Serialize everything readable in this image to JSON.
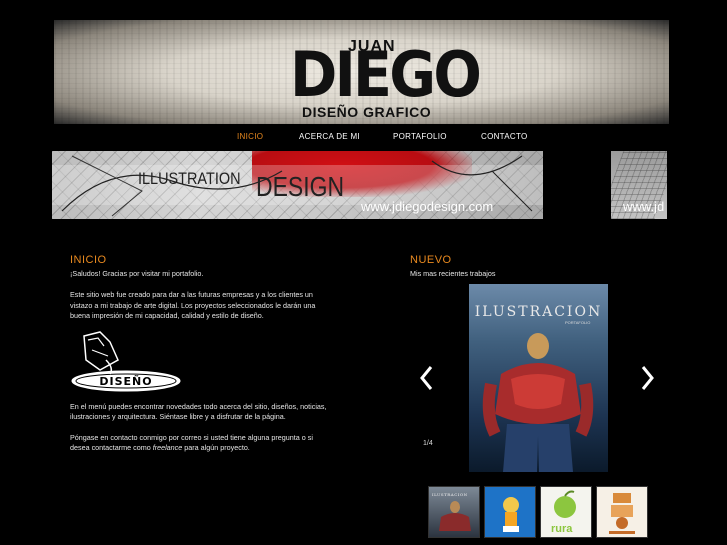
{
  "header": {
    "logo_juan": "JUAN",
    "logo_diego": "DIEGO",
    "logo_subtitle": "DISEÑO GRAFICO"
  },
  "nav": {
    "items": [
      {
        "label": "INICIO",
        "active": true
      },
      {
        "label": "ACERCA DE MI",
        "active": false
      },
      {
        "label": "PORTAFOLIO",
        "active": false
      },
      {
        "label": "CONTACTO",
        "active": false
      }
    ],
    "active_color": "#e8891f"
  },
  "banner": {
    "word1": "ILLUSTRATION",
    "word2": "DESIGN",
    "url": "www.jdiegodesign.com",
    "side_url": "www.jd"
  },
  "inicio": {
    "heading": "INICIO",
    "greeting": "¡Saludos! Gracias por visitar mi portafolio.",
    "intro": "Este sitio web fue creado para dar a las futuras empresas y a los clientes un vistazo a mi trabajo de arte digital. Los proyectos seleccionados le darán una buena impresión de mi capacidad, calidad y estilo de diseño.",
    "sketch_label": "DISEÑO",
    "menu_text": "En el menú puedes encontrar novedades todo acerca del sitio, diseños, noticias, ilustraciones y arquitectura. Siéntase libre y a disfrutar de la página.",
    "contact_text_before": "Póngase en contacto conmigo por correo si usted tiene alguna pregunta o si desea contactarme como ",
    "contact_text_em": "freelance",
    "contact_text_after": " para algún proyecto."
  },
  "nuevo": {
    "heading": "NUEVO",
    "subtitle": "Mis mas recientes trabajos",
    "poster_title": "ILUSTRACION",
    "poster_subtitle": "PORTAFOLIO",
    "counter": "1/4",
    "prev_icon": "chevron-left-icon",
    "next_icon": "chevron-right-icon",
    "thumbnails": [
      {
        "name": "thumb-ilustracion",
        "caption": "ILUSTRACION"
      },
      {
        "name": "thumb-boy-illustration"
      },
      {
        "name": "thumb-rura",
        "caption": "rura"
      },
      {
        "name": "thumb-ornament-logo"
      }
    ]
  },
  "colors": {
    "accent": "#e8891f",
    "background": "#000000",
    "text": "#e6e6e6"
  }
}
